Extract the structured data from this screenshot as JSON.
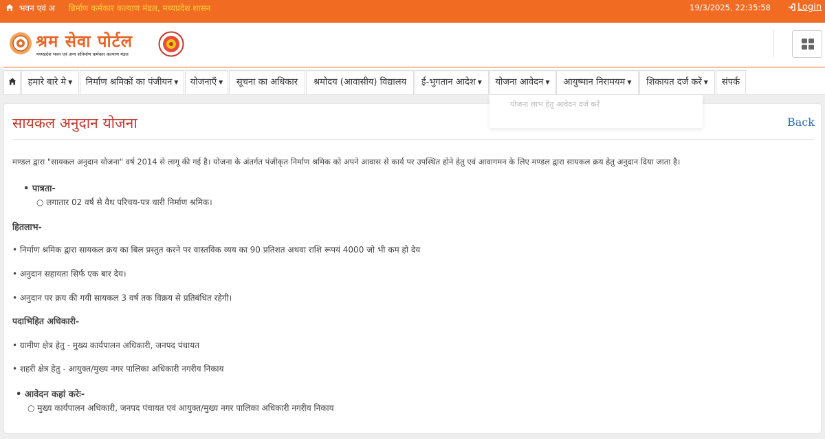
{
  "topbar": {
    "ticker_left": "भवन एवं अ",
    "ticker_right": "न्निर्माण कर्मकार कल्याण मंडल, मध्यप्रदेश शासन",
    "datetime": "19/3/2025, 22:35:58",
    "login": "Login",
    "colors": {
      "bar": "#f26b22",
      "ticker_accent": "#f7d33a"
    }
  },
  "header": {
    "brand": "श्रम सेवा पोर्टल",
    "brand_sub": "मध्यप्रदेश भवन एवं अन्य संनिर्माण कर्मकार कल्याण मंडल"
  },
  "nav": {
    "items": [
      {
        "label": "हमारे बारे मे",
        "dropdown": true
      },
      {
        "label": "निर्माण श्रमिकों का पंजीयन",
        "dropdown": true
      },
      {
        "label": "योजनाएँ",
        "dropdown": true
      },
      {
        "label": "सूचना का अधिकार",
        "dropdown": false
      },
      {
        "label": "श्रमोदय (आवासीय) विद्यालय",
        "dropdown": false
      },
      {
        "label": "ई-भुगतान आदेश",
        "dropdown": true
      },
      {
        "label": "योजना आवेदन",
        "dropdown": true
      },
      {
        "label": "आयुष्मान निरामयम",
        "dropdown": true
      },
      {
        "label": "शिकायत दर्ज करें",
        "dropdown": true
      },
      {
        "label": "संपर्क",
        "dropdown": false
      }
    ],
    "dropdown_items": [
      "योजना लाभ हेतु आवेदन दर्ज करें"
    ]
  },
  "content": {
    "title": "सायकल अनुदान योजना",
    "back": "Back",
    "intro": "मण्डल द्वारा \"सायकल अनुदान योजना\" वर्ष 2014 से लागू की गई है। योजना के अंतर्गत पंजीकृत निर्माण श्रमिक को अपने आवास से कार्य पर उपस्थित होने हेतु एवं आवागमन के लिए मण्डल द्वारा सायकल क्रय हेतु अनुदान दिया जाता है।",
    "eligibility_heading": "पात्रता-",
    "eligibility_item": "लगातार 02 वर्ष से वैध परिचय-पत्र धारी निर्माण श्रमिक।",
    "benefit_heading": "हितलाभ-",
    "benefits": [
      "• निर्माण श्रमिक द्वारा सायकल क्रय का बिल प्रस्तुत करने पर वास्तविक व्यय का 90 प्रतिशत अथवा राशि रूपयं 4000 जो भी कम हो देय",
      "• अनुदान सहायता सिर्फ एक बार देय।",
      "• अनुदान पर क्रय की गयी सायकल 3 वर्ष तक विक्रय से प्रतिबंधित रहेगी।"
    ],
    "officer_heading": "पदाभिहित अधिकारी-",
    "officers": [
      "• ग्रामीण क्षेत्र हेतु - मुख्य कार्यपालन अधिकारी, जनपद पंचायत",
      "• शहरी क्षेत्र हेतु - आयुक्त/मुख्य नगर पालिका अधिकारी नगरीय निकाय"
    ],
    "apply_heading": "आवेदन कहां करेः-",
    "apply_item": "मुख्य कार्यपालन अधिकारी, जनपद पंचायत एवं आयुक्त/मुख्य नगर पालिका अधिकारी नगरीय निकाय"
  }
}
